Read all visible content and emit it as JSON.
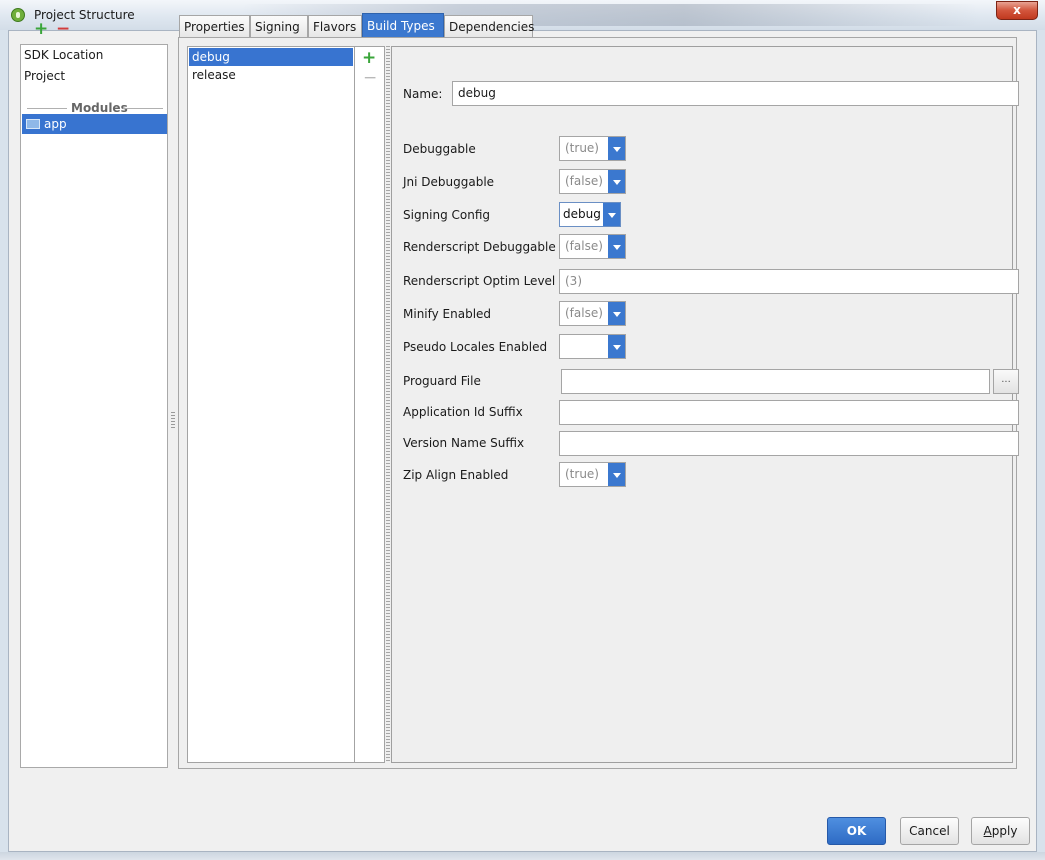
{
  "window": {
    "title": "Project Structure",
    "close_glyph": "x"
  },
  "left_panel": {
    "add_icon": "plus-icon",
    "remove_icon": "minus-icon",
    "items": [
      {
        "label": "SDK Location"
      },
      {
        "label": "Project"
      }
    ],
    "section_label": "Modules",
    "modules": [
      {
        "label": "app",
        "icon": "folder-icon",
        "selected": true
      }
    ]
  },
  "tabs": [
    {
      "label": "Properties",
      "active": false
    },
    {
      "label": "Signing",
      "active": false
    },
    {
      "label": "Flavors",
      "active": false
    },
    {
      "label": "Build Types",
      "active": true
    },
    {
      "label": "Dependencies",
      "active": false
    }
  ],
  "build_types": {
    "items": [
      {
        "label": "debug",
        "selected": true
      },
      {
        "label": "release",
        "selected": false
      }
    ],
    "add_icon": "plus-icon",
    "remove_icon": "minus-icon"
  },
  "form": {
    "name_label": "Name:",
    "name_value": "debug",
    "fields": {
      "debuggable": {
        "label": "Debuggable",
        "value": "(true)"
      },
      "jni_debuggable": {
        "label": "Jni Debuggable",
        "value": "(false)"
      },
      "signing_config": {
        "label": "Signing Config",
        "value": "debug"
      },
      "renderscript_debuggable": {
        "label": "Renderscript Debuggable",
        "value": "(false)"
      },
      "renderscript_optim_level": {
        "label": "Renderscript Optim Level",
        "value": "(3)"
      },
      "minify_enabled": {
        "label": "Minify Enabled",
        "value": "(false)"
      },
      "pseudo_locales_enabled": {
        "label": "Pseudo Locales Enabled",
        "value": ""
      },
      "proguard_file": {
        "label": "Proguard File",
        "value": "",
        "browse_label": "..."
      },
      "application_id_suffix": {
        "label": "Application Id Suffix",
        "value": ""
      },
      "version_name_suffix": {
        "label": "Version Name Suffix",
        "value": ""
      },
      "zip_align_enabled": {
        "label": "Zip Align Enabled",
        "value": "(true)"
      }
    }
  },
  "buttons": {
    "ok": "OK",
    "cancel": "Cancel",
    "apply_mnemonic": "A",
    "apply_rest": "pply"
  },
  "colors": {
    "selection": "#3874d0",
    "accent": "#3b78cf",
    "add_green": "#3aa53a",
    "remove_red": "#d23c3c"
  }
}
